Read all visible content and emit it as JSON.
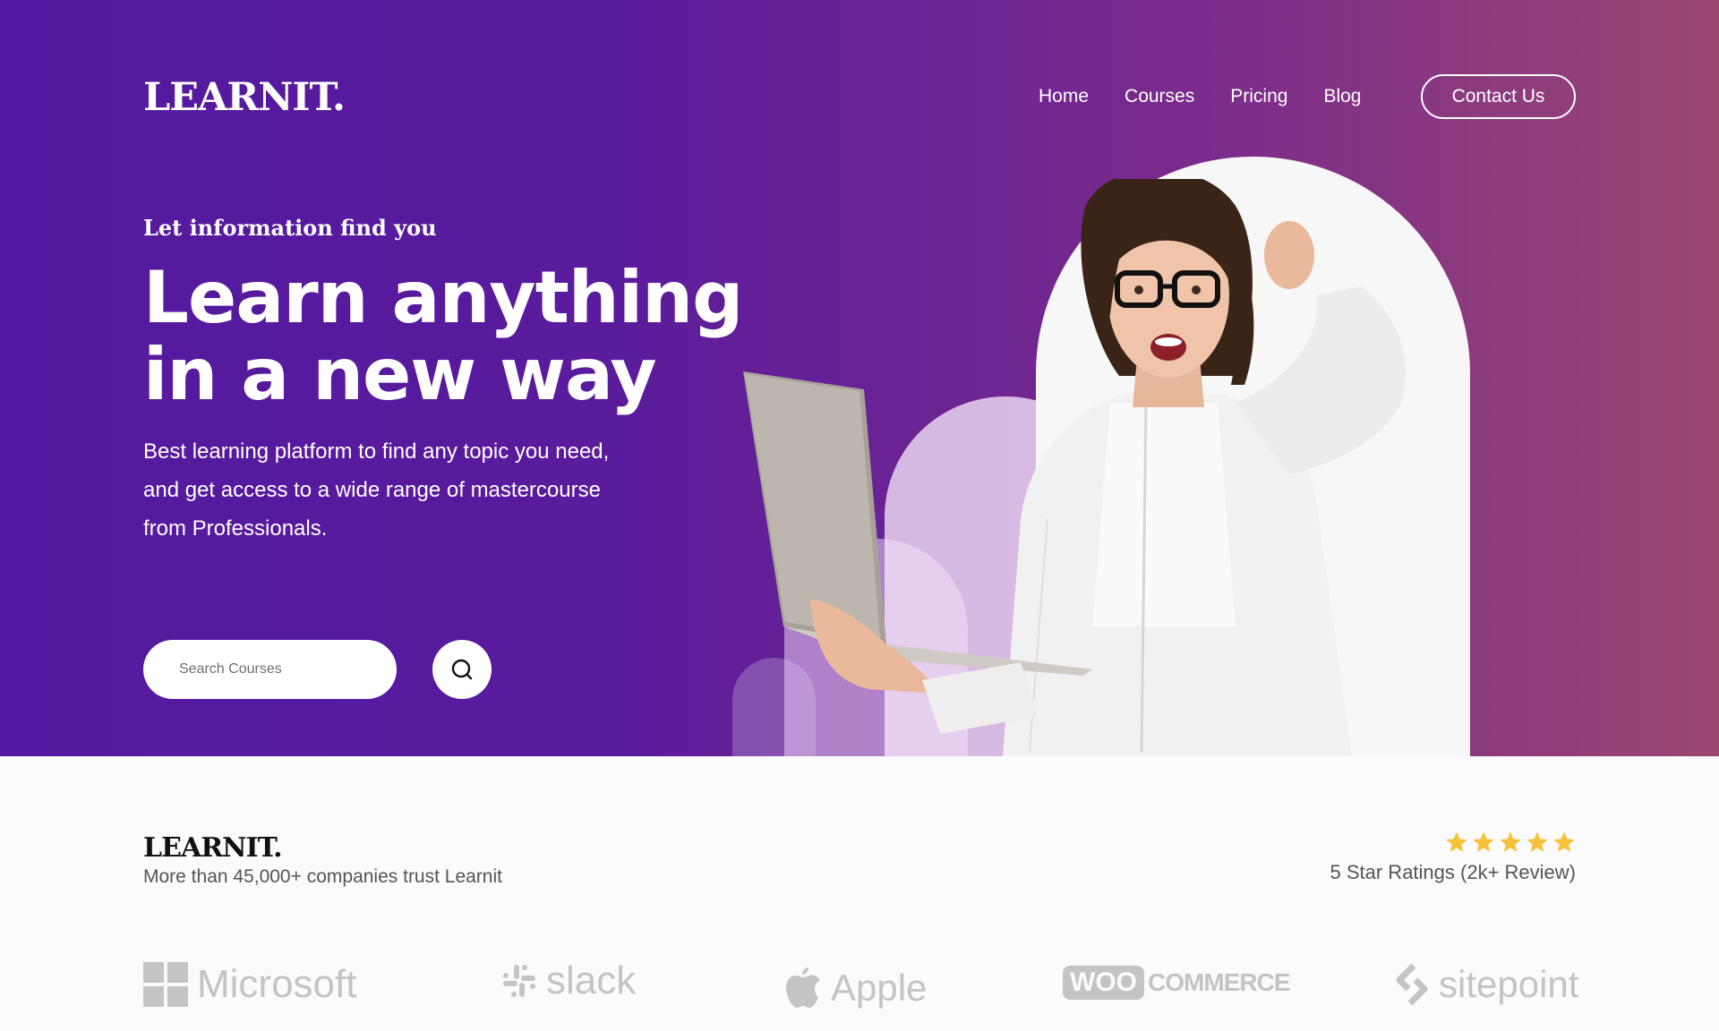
{
  "brand": {
    "name": "LEARNIT."
  },
  "nav": {
    "links": [
      "Home",
      "Courses",
      "Pricing",
      "Blog"
    ],
    "cta": "Contact Us"
  },
  "hero": {
    "tagline": "Let information find you",
    "headline_line1": "Learn anything",
    "headline_line2": "in a new way",
    "description": "Best learning platform to find any topic you need, and get access to a wide range of mastercourse from Professionals.",
    "search_placeholder": "Search Courses",
    "search_icon": "search-icon"
  },
  "trust": {
    "logo": "LEARNIT.",
    "text": "More than 45,000+ companies trust Learnit",
    "rating_stars": 5,
    "rating_text": "5 Star Ratings (2k+ Review)"
  },
  "partners": [
    {
      "name": "Microsoft",
      "icon": "microsoft-logo"
    },
    {
      "name": "slack",
      "icon": "slack-logo"
    },
    {
      "name": "Apple",
      "icon": "apple-logo"
    },
    {
      "name": "COMMERCE",
      "prefix": "WOO",
      "icon": "woocommerce-logo"
    },
    {
      "name": "sitepoint",
      "icon": "sitepoint-logo"
    }
  ],
  "colors": {
    "hero_gradient_start": "#5419a0",
    "hero_gradient_end": "#9a4772",
    "star": "#f7c23b",
    "partner_gray": "#c4c4c4"
  }
}
